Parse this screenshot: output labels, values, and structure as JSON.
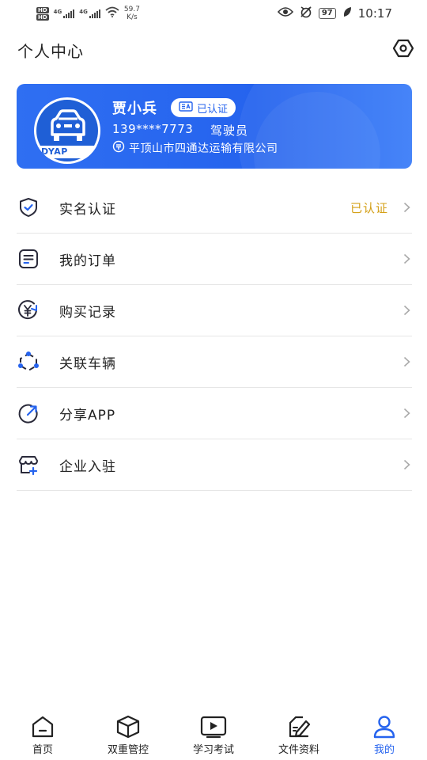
{
  "status_bar": {
    "hd1": "HD",
    "hd2": "HD",
    "net1": "4G",
    "net2": "4G",
    "speed_value": "59.7",
    "speed_unit": "K/s",
    "battery": "97",
    "time": "10:17"
  },
  "header": {
    "title": "个人中心"
  },
  "profile": {
    "avatar_text": "DYAP",
    "name": "贾小兵",
    "verify_label": "已认证",
    "phone": "139****7773",
    "role": "驾驶员",
    "company": "平顶山市四通达运输有限公司"
  },
  "menu": {
    "items": [
      {
        "label": "实名认证",
        "status": "已认证",
        "icon": "shield-check-icon"
      },
      {
        "label": "我的订单",
        "status": "",
        "icon": "order-list-icon"
      },
      {
        "label": "购买记录",
        "status": "",
        "icon": "yuan-circle-icon"
      },
      {
        "label": "关联车辆",
        "status": "",
        "icon": "link-nodes-icon"
      },
      {
        "label": "分享APP",
        "status": "",
        "icon": "share-arrow-icon"
      },
      {
        "label": "企业入驻",
        "status": "",
        "icon": "store-plus-icon"
      }
    ]
  },
  "tabs": [
    {
      "label": "首页",
      "icon": "home-icon"
    },
    {
      "label": "双重管控",
      "icon": "cube-icon"
    },
    {
      "label": "学习考试",
      "icon": "video-play-icon"
    },
    {
      "label": "文件资料",
      "icon": "document-pen-icon"
    },
    {
      "label": "我的",
      "icon": "user-icon"
    }
  ],
  "colors": {
    "primary": "#2563ee",
    "verified_status": "#d4a017",
    "divider": "#e6e6e6"
  }
}
